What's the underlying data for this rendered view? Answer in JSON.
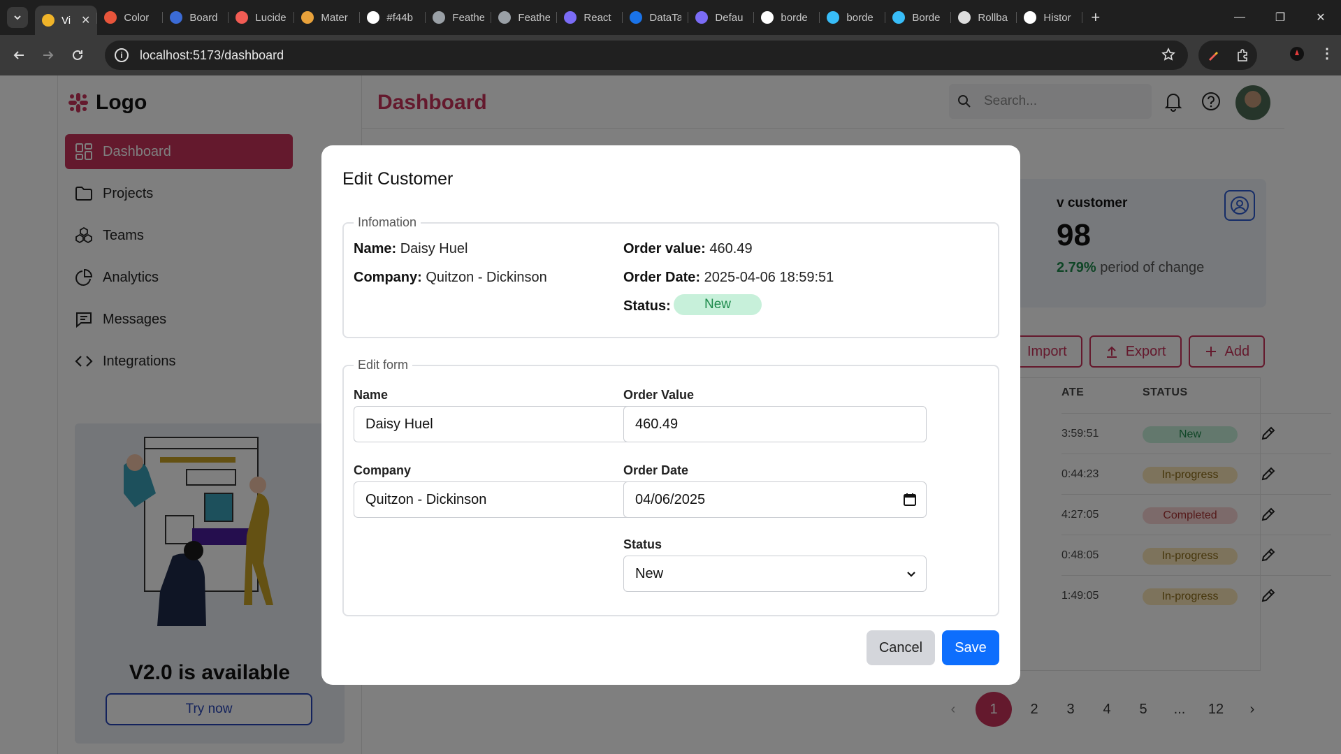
{
  "browser": {
    "tabs": [
      {
        "title": "Vi",
        "color": "#f0b429",
        "active": true
      },
      {
        "title": "Color",
        "color": "#e8553b"
      },
      {
        "title": "Board",
        "color": "#3b6bd6"
      },
      {
        "title": "Lucide",
        "color": "#f25c54"
      },
      {
        "title": "Mater",
        "color": "#e9a23b"
      },
      {
        "title": "#f44b",
        "color": "#ffffff"
      },
      {
        "title": "Feathe",
        "color": "#9aa0a6"
      },
      {
        "title": "Feathe",
        "color": "#9aa0a6"
      },
      {
        "title": "React",
        "color": "#7b6cf6"
      },
      {
        "title": "DataTa",
        "color": "#1a73e8"
      },
      {
        "title": "Defau",
        "color": "#7b6cf6"
      },
      {
        "title": "borde",
        "color": "#ffffff"
      },
      {
        "title": "borde",
        "color": "#38bdf8"
      },
      {
        "title": "Borde",
        "color": "#38bdf8"
      },
      {
        "title": "Rollba",
        "color": "#dddddd"
      },
      {
        "title": "Histor",
        "color": "#ffffff"
      }
    ],
    "url": "localhost:5173/dashboard"
  },
  "sidebar": {
    "logo_text": "Logo",
    "items": [
      {
        "label": "Dashboard",
        "icon": "grid-icon",
        "active": true
      },
      {
        "label": "Projects",
        "icon": "folder-icon"
      },
      {
        "label": "Teams",
        "icon": "boxes-icon"
      },
      {
        "label": "Analytics",
        "icon": "pie-chart-icon"
      },
      {
        "label": "Messages",
        "icon": "message-icon"
      },
      {
        "label": "Integrations",
        "icon": "code-icon"
      }
    ],
    "promo_title": "V2.0 is available",
    "promo_button": "Try now"
  },
  "header": {
    "title": "Dashboard",
    "search_placeholder": "Search..."
  },
  "stat": {
    "label": "v customer",
    "value": "98",
    "change": "2.79%",
    "change_suffix": " period of change"
  },
  "actions": {
    "import": "Import",
    "export": "Export",
    "add": "Add"
  },
  "table": {
    "col_date": "ATE",
    "col_status": "STATUS",
    "rows": [
      {
        "time": "3:59:51",
        "status": "New",
        "kind": "new"
      },
      {
        "time": "0:44:23",
        "status": "In-progress",
        "kind": "prog"
      },
      {
        "time": "4:27:05",
        "status": "Completed",
        "kind": "done"
      },
      {
        "time": "0:48:05",
        "status": "In-progress",
        "kind": "prog"
      },
      {
        "time": "1:49:05",
        "status": "In-progress",
        "kind": "prog"
      }
    ]
  },
  "pagination": {
    "prev": "‹",
    "pages": [
      "1",
      "2",
      "3",
      "4",
      "5",
      "...",
      "12"
    ],
    "next": "›"
  },
  "modal": {
    "title": "Edit Customer",
    "info_legend": "Infomation",
    "name_key": "Name:",
    "name_val": "Daisy Huel",
    "company_key": "Company:",
    "company_val": "Quitzon - Dickinson",
    "order_value_key": "Order value:",
    "order_value_val": "460.49",
    "order_date_key": "Order Date:",
    "order_date_val": "2025-04-06 18:59:51",
    "status_key": "Status:",
    "status_val": "New",
    "form_legend": "Edit form",
    "form": {
      "name_label": "Name",
      "name_value": "Daisy Huel",
      "company_label": "Company",
      "company_value": "Quitzon - Dickinson",
      "order_value_label": "Order Value",
      "order_value_value": "460.49",
      "order_date_label": "Order Date",
      "order_date_value": "04/06/2025",
      "status_label": "Status",
      "status_value": "New"
    },
    "cancel": "Cancel",
    "save": "Save"
  },
  "colors": {
    "brand": "#c8335a",
    "primary": "#0d6efd",
    "success_bg": "#c7f0da",
    "success_text": "#1e8b4c"
  }
}
